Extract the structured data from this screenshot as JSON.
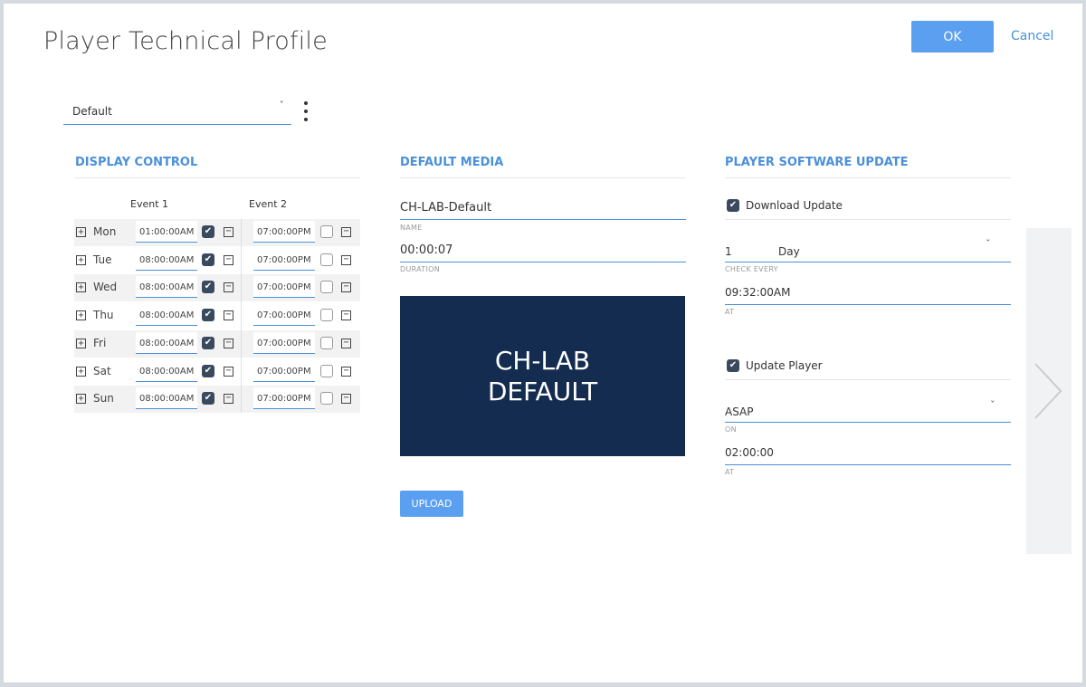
{
  "page": {
    "title": "Player Technical Profile"
  },
  "actions": {
    "ok_label": "OK",
    "cancel_label": "Cancel"
  },
  "profile": {
    "selected": "Default"
  },
  "display_control": {
    "title": "DISPLAY CONTROL",
    "event1_label": "Event 1",
    "event2_label": "Event 2",
    "rows": [
      {
        "day": "Mon",
        "event1": "01:00:00AM",
        "event1_checked": true,
        "event2": "07:00:00PM",
        "event2_checked": false
      },
      {
        "day": "Tue",
        "event1": "08:00:00AM",
        "event1_checked": true,
        "event2": "07:00:00PM",
        "event2_checked": false
      },
      {
        "day": "Wed",
        "event1": "08:00:00AM",
        "event1_checked": true,
        "event2": "07:00:00PM",
        "event2_checked": false
      },
      {
        "day": "Thu",
        "event1": "08:00:00AM",
        "event1_checked": true,
        "event2": "07:00:00PM",
        "event2_checked": false
      },
      {
        "day": "Fri",
        "event1": "08:00:00AM",
        "event1_checked": true,
        "event2": "07:00:00PM",
        "event2_checked": false
      },
      {
        "day": "Sat",
        "event1": "08:00:00AM",
        "event1_checked": true,
        "event2": "07:00:00PM",
        "event2_checked": false
      },
      {
        "day": "Sun",
        "event1": "08:00:00AM",
        "event1_checked": true,
        "event2": "07:00:00PM",
        "event2_checked": false
      }
    ]
  },
  "default_media": {
    "title": "DEFAULT MEDIA",
    "name_value": "CH-LAB-Default",
    "name_caption": "NAME",
    "duration_value": "00:00:07",
    "duration_caption": "DURATION",
    "preview_line1": "CH-LAB",
    "preview_line2": "DEFAULT",
    "upload_label": "UPLOAD"
  },
  "software_update": {
    "title": "PLAYER SOFTWARE UPDATE",
    "download_label": "Download Update",
    "download_checked": true,
    "check_every_value": "1",
    "check_every_unit": "Day",
    "check_every_caption": "CHECK EVERY",
    "at_value": "09:32:00AM",
    "at_caption": "AT",
    "update_player_label": "Update Player",
    "update_player_checked": true,
    "on_value": "ASAP",
    "on_caption": "ON",
    "at2_value": "02:00:00",
    "at2_caption": "AT"
  },
  "colors": {
    "accent": "#4a90d9",
    "button": "#5b9ff0",
    "preview_bg": "#142c4f",
    "checkbox_on": "#3a4a5e"
  },
  "icons": {
    "expand": "plus-box-icon",
    "remove": "minus-box-icon",
    "next": "chevron-right-icon",
    "more": "kebab-menu-icon"
  }
}
